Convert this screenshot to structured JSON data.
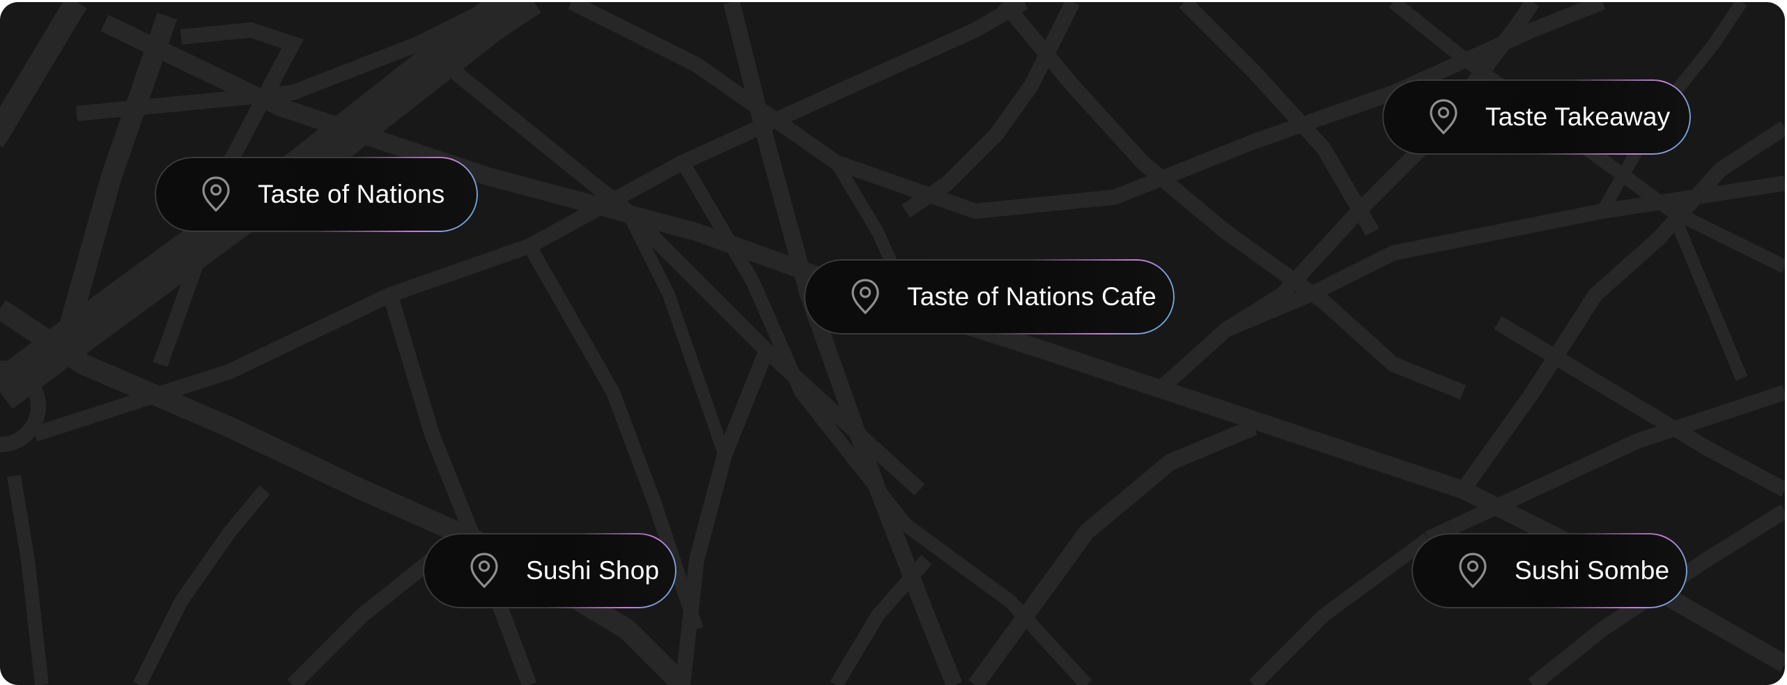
{
  "map": {
    "background_color": "#181818",
    "road_color": "#272727",
    "pin_icon": "map-pin-icon",
    "accent_gradient": [
      "#c77dd8",
      "#4fb3d9"
    ],
    "locations": [
      {
        "id": "taste-of-nations",
        "label": "Taste of Nations"
      },
      {
        "id": "taste-takeaway",
        "label": "Taste Takeaway"
      },
      {
        "id": "taste-of-nations-cafe",
        "label": "Taste of Nations Cafe"
      },
      {
        "id": "sushi-shop",
        "label": "Sushi Shop"
      },
      {
        "id": "sushi-sombe",
        "label": "Sushi Sombe"
      }
    ]
  }
}
